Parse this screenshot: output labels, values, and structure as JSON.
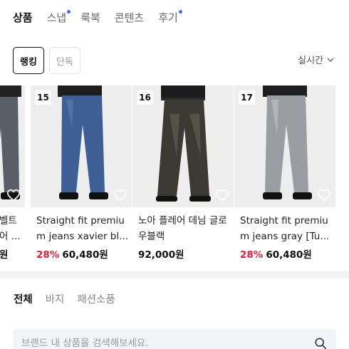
{
  "top_tabs": [
    {
      "label": "상품",
      "active": true,
      "dot": false
    },
    {
      "label": "스냅",
      "active": false,
      "dot": true
    },
    {
      "label": "룩북",
      "active": false,
      "dot": false
    },
    {
      "label": "콘텐츠",
      "active": false,
      "dot": false
    },
    {
      "label": "후기",
      "active": false,
      "dot": true
    }
  ],
  "filters": [
    {
      "label": "랭킹",
      "active": true
    },
    {
      "label": "단독",
      "active": false
    }
  ],
  "sort": {
    "label": "실시간",
    "icon": "chevron-down-icon"
  },
  "products": [
    {
      "rank": "",
      "title": "노아 스트레이트 벨트 데님 그레이 블랙",
      "title_visible_lines": [
        "벨트",
        "어 ..."
      ],
      "discount": "",
      "price": "원",
      "pants_color": "#5a5e66",
      "partial": true
    },
    {
      "rank": "15",
      "title": "Straight fit premium jeans xavier bl...",
      "discount": "28%",
      "price": "60,480원",
      "pants_color": "#3d5f95"
    },
    {
      "rank": "16",
      "title": "노아 플레어 데님 글로우블랙",
      "discount": "",
      "price": "92,000원",
      "pants_color": "#3a3a33"
    },
    {
      "rank": "17",
      "title": "Straight fit premium jeans gray [Tu...",
      "discount": "28%",
      "price": "60,480원",
      "pants_color": "#9a9ea3"
    }
  ],
  "category_tabs": [
    {
      "label": "전체",
      "active": true
    },
    {
      "label": "바지",
      "active": false
    },
    {
      "label": "패션소품",
      "active": false
    }
  ],
  "search": {
    "placeholder": "브랜드 내 상품을 검색해보세요.",
    "value": "",
    "icon": "search-icon"
  },
  "colors": {
    "accent_dot": "#3b6bf5",
    "discount_red": "#e0203a"
  }
}
